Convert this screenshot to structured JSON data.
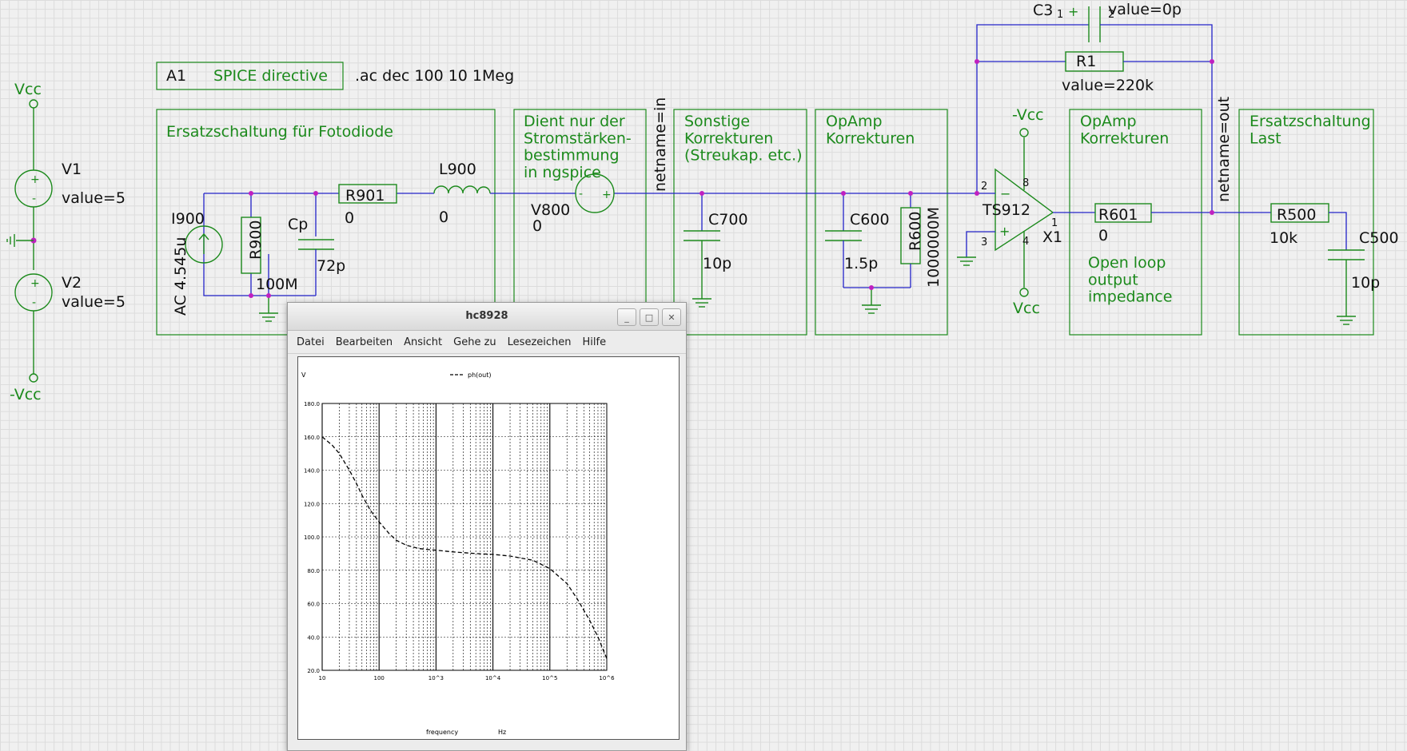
{
  "schematic": {
    "directive": {
      "id": "A1",
      "type": "SPICE directive",
      "text": ".ac dec 100 10 1Meg"
    },
    "groups": [
      {
        "key": "fotodiode",
        "label": "Ersatzschaltung für Fotodiode"
      },
      {
        "key": "strom",
        "label": "Dient nur der\nStromstärken-\nbestimmung\nin ngspice"
      },
      {
        "key": "sonstige",
        "label": "Sonstige\nKorrekturen\n(Streukap. etc.)"
      },
      {
        "key": "opamp1",
        "label": "OpAmp\nKorrekturen"
      },
      {
        "key": "opamp2",
        "label": "OpAmp\nKorrekturen"
      },
      {
        "key": "last",
        "label": "Ersatzschaltung\nLast"
      }
    ],
    "sources": {
      "vcc_top": "Vcc",
      "vcc_bottom": "-Vcc",
      "v1": "V1",
      "v1_value": "value=5",
      "v2": "V2",
      "v2_value": "value=5"
    },
    "components": {
      "i900": "I900",
      "i900_value": "AC 4.545u",
      "r900": "R900",
      "r900_value": "100M",
      "cp": "Cp",
      "cp_value": "72p",
      "r901": "R901",
      "r901_value": "0",
      "l900": "L900",
      "l900_value": "0",
      "v800": "V800",
      "v800_value": "0",
      "c700": "C700",
      "c700_value": "10p",
      "c600": "C600",
      "c600_value": "1.5p",
      "r600": "R600",
      "r600_value": "1000000M",
      "c3": "C3",
      "c3_value": "value=0p",
      "r1": "R1",
      "r1_value": "value=220k",
      "opamp": "TS912",
      "opamp_ref": "X1",
      "opamp_neg_supply": "-Vcc",
      "opamp_pos_supply": "Vcc",
      "pin2": "2",
      "pin3": "3",
      "pin8": "8",
      "pin4": "4",
      "pin1": "1",
      "c3_pin1": "1",
      "c3_pin2": "2",
      "r601": "R601",
      "r601_value": "0",
      "open_loop": "Open loop\noutput\nimpedance",
      "r500": "R500",
      "r500_value": "10k",
      "c500": "C500",
      "c500_value": "10p"
    },
    "nets": {
      "in": "netname=in",
      "out": "netname=out"
    }
  },
  "viewer": {
    "title": "hc8928",
    "menu": [
      "Datei",
      "Bearbeiten",
      "Ansicht",
      "Gehe zu",
      "Lesezeichen",
      "Hilfe"
    ]
  },
  "chart_data": {
    "type": "line",
    "ylabel": "V",
    "xlabel": "frequency",
    "xunit": "Hz",
    "xscale": "log",
    "xlim": [
      10,
      1000000
    ],
    "ylim": [
      20,
      180
    ],
    "xticks": [
      "10",
      "100",
      "10^3",
      "10^4",
      "10^5",
      "10^6"
    ],
    "yticks": [
      "20.0",
      "40.0",
      "60.0",
      "80.0",
      "100.0",
      "120.0",
      "140.0",
      "160.0",
      "180.0"
    ],
    "grid": true,
    "legend_placement": "top-center",
    "series": [
      {
        "name": "ph(out)",
        "style": "dashed",
        "x": [
          10,
          15,
          20,
          30,
          40,
          50,
          70,
          100,
          150,
          200,
          300,
          500,
          1000,
          2000,
          5000,
          10000,
          20000,
          50000,
          100000,
          200000,
          300000,
          500000,
          700000,
          1000000
        ],
        "y": [
          160,
          155,
          150,
          140,
          132,
          125,
          116,
          109,
          102,
          98,
          95,
          93,
          92,
          91,
          90,
          89.5,
          88.5,
          86,
          81,
          72,
          63,
          50,
          40,
          27
        ]
      }
    ]
  }
}
